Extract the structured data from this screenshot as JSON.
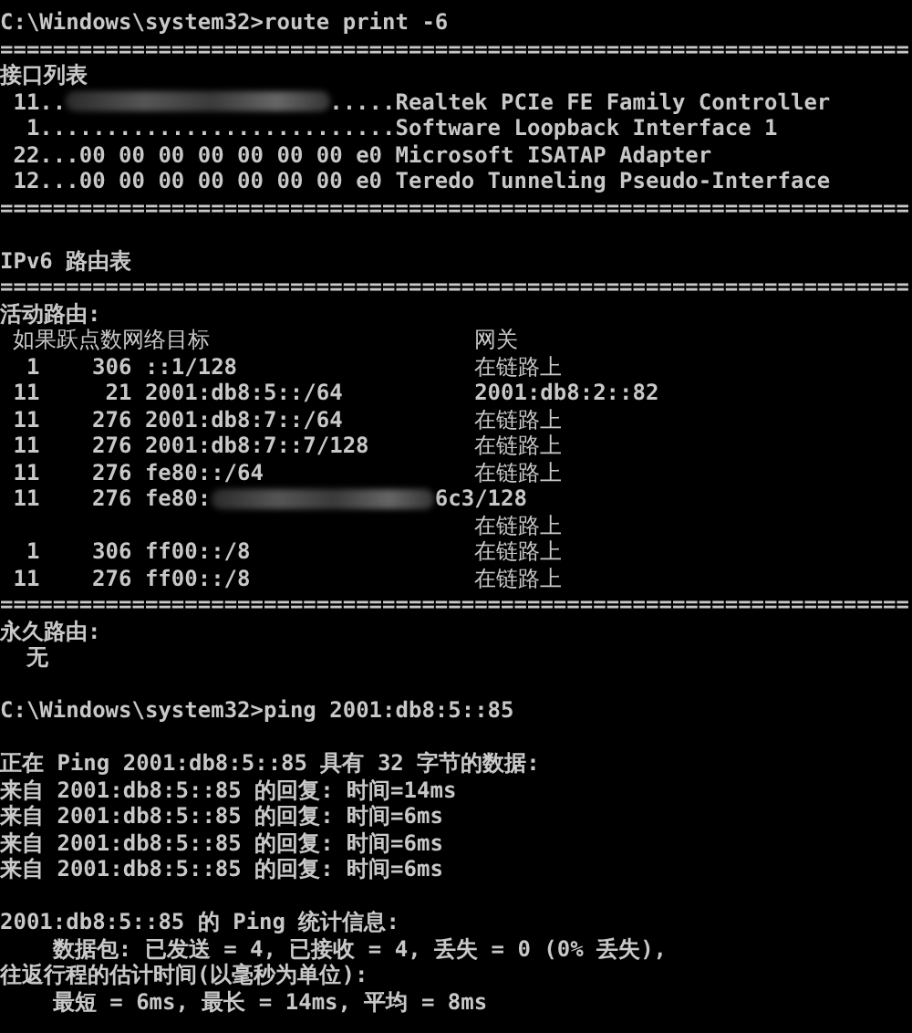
{
  "console": {
    "lines": [
      {
        "kind": "text",
        "text": "C:\\Windows\\system32>route print -6"
      },
      {
        "kind": "rule",
        "text": "====================================================================="
      },
      {
        "kind": "text",
        "text": "接口列表"
      },
      {
        "kind": "redacted",
        "before": " 11..",
        "after": ".....Realtek PCIe FE Family Controller"
      },
      {
        "kind": "text",
        "text": "  1...........................Software Loopback Interface 1"
      },
      {
        "kind": "text",
        "text": " 22...00 00 00 00 00 00 00 e0 Microsoft ISATAP Adapter"
      },
      {
        "kind": "text",
        "text": " 12...00 00 00 00 00 00 00 e0 Teredo Tunneling Pseudo-Interface"
      },
      {
        "kind": "rule",
        "text": "====================================================================="
      },
      {
        "kind": "blank"
      },
      {
        "kind": "text",
        "text": "IPv6 路由表"
      },
      {
        "kind": "rule",
        "text": "====================================================================="
      },
      {
        "kind": "text",
        "text": "活动路由:"
      },
      {
        "kind": "route_header",
        "labels": [
          "如果跃点数网络目标",
          "网关"
        ]
      },
      {
        "kind": "route",
        "interface": "1",
        "metric": "306",
        "destination": "::1/128",
        "gateway": "在链路上"
      },
      {
        "kind": "route",
        "interface": "11",
        "metric": "21",
        "destination": "2001:db8:5::/64",
        "gateway": "2001:db8:2::82"
      },
      {
        "kind": "route",
        "interface": "11",
        "metric": "276",
        "destination": "2001:db8:7::/64",
        "gateway": "在链路上"
      },
      {
        "kind": "route",
        "interface": "11",
        "metric": "276",
        "destination": "2001:db8:7::7/128",
        "gateway": "在链路上"
      },
      {
        "kind": "route",
        "interface": "11",
        "metric": "276",
        "destination": "fe80::/64",
        "gateway": "在链路上"
      },
      {
        "kind": "route_redacted",
        "interface": "11",
        "metric": "276",
        "destination": "fe80:",
        "destination_end": "6c3/128",
        "gateway": "在链路上"
      },
      {
        "kind": "route",
        "interface": "1",
        "metric": "306",
        "destination": "ff00::/8",
        "gateway": "在链路上"
      },
      {
        "kind": "route",
        "interface": "11",
        "metric": "276",
        "destination": "ff00::/8",
        "gateway": "在链路上"
      },
      {
        "kind": "rule",
        "text": "====================================================================="
      },
      {
        "kind": "text",
        "text": "永久路由:"
      },
      {
        "kind": "text",
        "text": "  无"
      },
      {
        "kind": "blank"
      },
      {
        "kind": "text",
        "text": "C:\\Windows\\system32>ping 2001:db8:5::85"
      },
      {
        "kind": "blank"
      },
      {
        "kind": "text",
        "text": "正在 Ping 2001:db8:5::85 具有 32 字节的数据:"
      },
      {
        "kind": "text",
        "text": "来自 2001:db8:5::85 的回复: 时间=14ms"
      },
      {
        "kind": "text",
        "text": "来自 2001:db8:5::85 的回复: 时间=6ms"
      },
      {
        "kind": "text",
        "text": "来自 2001:db8:5::85 的回复: 时间=6ms"
      },
      {
        "kind": "text",
        "text": "来自 2001:db8:5::85 的回复: 时间=6ms"
      },
      {
        "kind": "blank"
      },
      {
        "kind": "text",
        "text": "2001:db8:5::85 的 Ping 统计信息:"
      },
      {
        "kind": "text",
        "text": "    数据包: 已发送 = 4, 已接收 = 4, 丢失 = 0 (0% 丢失),"
      },
      {
        "kind": "text",
        "text": "往返行程的估计时间(以毫秒为单位):"
      },
      {
        "kind": "text",
        "text": "    最短 = 6ms, 最长 = 14ms, 平均 = 8ms"
      }
    ]
  }
}
